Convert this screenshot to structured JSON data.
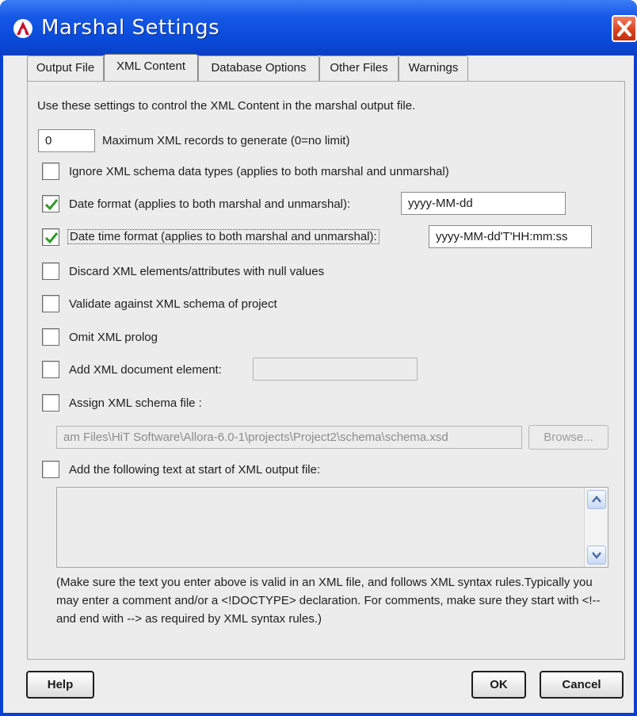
{
  "window": {
    "title": "Marshal Settings"
  },
  "tabs": [
    {
      "label": "Output File"
    },
    {
      "label": "XML Content"
    },
    {
      "label": "Database Options"
    },
    {
      "label": "Other Files"
    },
    {
      "label": "Warnings"
    }
  ],
  "active_tab": "XML Content",
  "content": {
    "intro": "Use these settings to control the XML Content in the marshal output file.",
    "max_records": {
      "value": "0",
      "label": "Maximum XML records to generate (0=no limit)"
    },
    "ignore_types": {
      "checked": false,
      "label": "Ignore XML schema data types (applies to both marshal and unmarshal)"
    },
    "date_format": {
      "checked": true,
      "label": "Date format (applies to both marshal and unmarshal):",
      "value": "yyyy-MM-dd"
    },
    "datetime_format": {
      "checked": true,
      "label": "Date time format (applies to both marshal and unmarshal):",
      "value": "yyyy-MM-dd'T'HH:mm:ss"
    },
    "discard_null": {
      "checked": false,
      "label": "Discard XML elements/attributes with null values"
    },
    "validate_schema": {
      "checked": false,
      "label": "Validate against XML schema of project"
    },
    "omit_prolog": {
      "checked": false,
      "label": "Omit XML prolog"
    },
    "add_doc_element": {
      "checked": false,
      "label": "Add XML document element:",
      "value": ""
    },
    "assign_schema": {
      "checked": false,
      "label": "Assign XML schema file :",
      "path": "am Files\\HiT Software\\Allora-6.0-1\\projects\\Project2\\schema\\schema.xsd",
      "browse_label": "Browse..."
    },
    "add_text": {
      "checked": false,
      "label": "Add the following text at start of XML output file:",
      "value": ""
    },
    "note": "(Make sure the text you enter above is valid in an XML file, and follows XML syntax rules.Typically you may enter a comment and/or a <!DOCTYPE> declaration. For comments, make sure they start with <!-- and end with --> as required by XML syntax rules.)"
  },
  "buttons": {
    "help": "Help",
    "ok": "OK",
    "cancel": "Cancel"
  },
  "colors": {
    "titlebar": "#0a4ad9",
    "close": "#d8401c",
    "check": "#2e9a28",
    "panel": "#ececec"
  }
}
